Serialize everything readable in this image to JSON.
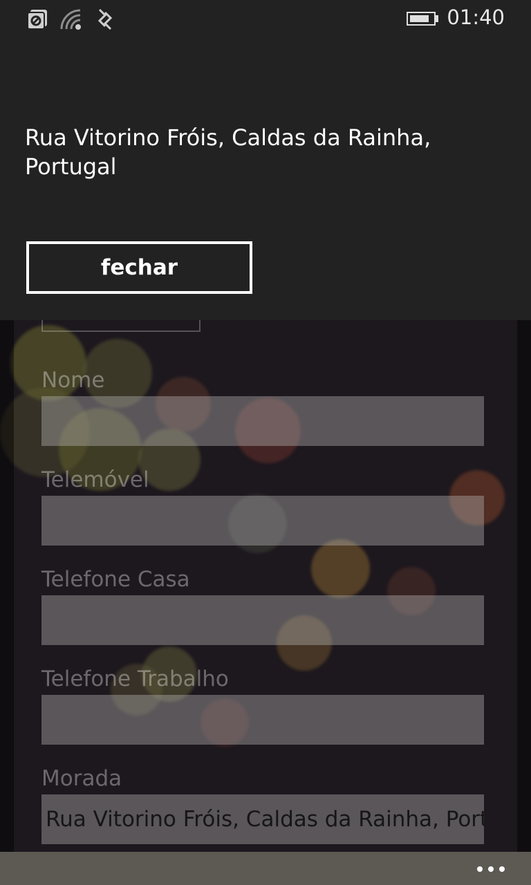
{
  "status_bar": {
    "time": "01:40",
    "battery_level": 0.85,
    "icons": [
      "nfc-icon",
      "wifi-icon",
      "data-connection-icon"
    ]
  },
  "popup": {
    "message": "Rua Vitorino Fróis, Caldas da Rainha, Portugal",
    "close_button_label": "fechar"
  },
  "form": {
    "fields": [
      {
        "label": "Nome",
        "value": ""
      },
      {
        "label": "Telemóvel",
        "value": ""
      },
      {
        "label": "Telefone Casa",
        "value": ""
      },
      {
        "label": "Telefone Trabalho",
        "value": ""
      },
      {
        "label": "Morada",
        "value": "Rua Vitorino Fróis, Caldas da Rainha, Portugal"
      }
    ]
  },
  "app_bar": {
    "more_icon": "ellipsis-icon"
  },
  "colors": {
    "popup_background": "#222222",
    "app_bar_background": "#5c5a53",
    "page_background": "#221c22"
  }
}
